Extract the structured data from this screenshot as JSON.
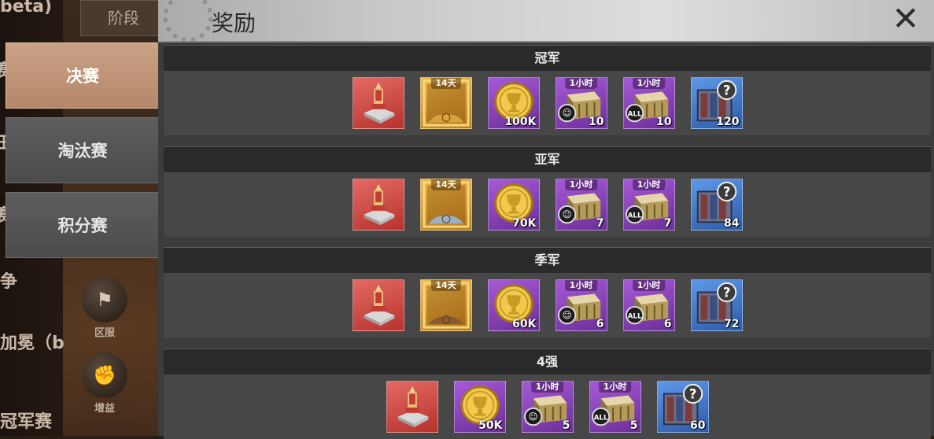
{
  "background": {
    "stage_tab": "阶段",
    "left_texts": [
      "beta)",
      "赛",
      "田",
      "赛",
      "争",
      "加冕（b",
      "冠军赛"
    ],
    "nav": [
      {
        "label": "区服",
        "icon": "flag-icon"
      },
      {
        "label": "增益",
        "icon": "fist-icon"
      }
    ]
  },
  "sidebar": {
    "tabs": [
      {
        "label": "决赛",
        "active": true
      },
      {
        "label": "淘汰赛",
        "active": false
      },
      {
        "label": "积分赛",
        "active": false
      }
    ]
  },
  "modal": {
    "title": "奖励",
    "close_icon": "close-icon",
    "tiers": [
      {
        "name": "冠军",
        "items": [
          {
            "icon": "throne-icon",
            "rarity": "red",
            "top": "",
            "qty": ""
          },
          {
            "icon": "golden-frame-icon",
            "rarity": "gold",
            "top": "14天",
            "qty": ""
          },
          {
            "icon": "gold-coin-icon",
            "rarity": "purple",
            "top": "",
            "qty": "100K"
          },
          {
            "icon": "soldier-speedup-icon",
            "rarity": "purple",
            "top": "1小时",
            "qty": "10"
          },
          {
            "icon": "all-speedup-icon",
            "rarity": "purple",
            "top": "1小时",
            "qty": "10"
          },
          {
            "icon": "mystery-crate-icon",
            "rarity": "blue",
            "top": "",
            "qty": "120"
          }
        ]
      },
      {
        "name": "亚军",
        "items": [
          {
            "icon": "throne-icon",
            "rarity": "red",
            "top": "",
            "qty": ""
          },
          {
            "icon": "silver-frame-icon",
            "rarity": "gold",
            "top": "14天",
            "qty": ""
          },
          {
            "icon": "gold-coin-icon",
            "rarity": "purple",
            "top": "",
            "qty": "70K"
          },
          {
            "icon": "soldier-speedup-icon",
            "rarity": "purple",
            "top": "1小时",
            "qty": "7"
          },
          {
            "icon": "all-speedup-icon",
            "rarity": "purple",
            "top": "1小时",
            "qty": "7"
          },
          {
            "icon": "mystery-crate-icon",
            "rarity": "blue",
            "top": "",
            "qty": "84"
          }
        ]
      },
      {
        "name": "季军",
        "items": [
          {
            "icon": "throne-icon",
            "rarity": "red",
            "top": "",
            "qty": ""
          },
          {
            "icon": "bronze-frame-icon",
            "rarity": "gold",
            "top": "14天",
            "qty": ""
          },
          {
            "icon": "gold-coin-icon",
            "rarity": "purple",
            "top": "",
            "qty": "60K"
          },
          {
            "icon": "soldier-speedup-icon",
            "rarity": "purple",
            "top": "1小时",
            "qty": "6"
          },
          {
            "icon": "all-speedup-icon",
            "rarity": "purple",
            "top": "1小时",
            "qty": "6"
          },
          {
            "icon": "mystery-crate-icon",
            "rarity": "blue",
            "top": "",
            "qty": "72"
          }
        ]
      },
      {
        "name": "4强",
        "items": [
          {
            "icon": "throne-icon",
            "rarity": "red",
            "top": "",
            "qty": ""
          },
          {
            "icon": "gold-coin-icon",
            "rarity": "purple",
            "top": "",
            "qty": "50K"
          },
          {
            "icon": "soldier-speedup-icon",
            "rarity": "purple",
            "top": "1小时",
            "qty": "5"
          },
          {
            "icon": "all-speedup-icon",
            "rarity": "purple",
            "top": "1小时",
            "qty": "5"
          },
          {
            "icon": "mystery-crate-icon",
            "rarity": "blue",
            "top": "",
            "qty": "60"
          }
        ]
      }
    ]
  },
  "colors": {
    "rarity_red": "#c9443e",
    "rarity_gold": "#d99a2b",
    "rarity_purple": "#8a43b8",
    "rarity_blue": "#3f72c8",
    "active_tab": "#c09476"
  }
}
